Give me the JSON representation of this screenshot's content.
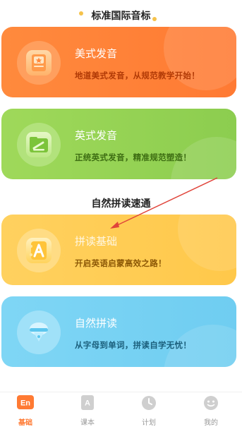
{
  "section1": {
    "title": "标准国际音标"
  },
  "section2": {
    "title": "自然拼读速通"
  },
  "cards": [
    {
      "title": "美式发音",
      "subtitle": "地道美式发音，从规范教学开始！",
      "icon": "book-icon"
    },
    {
      "title": "英式发音",
      "subtitle": "正统英式发音，精准规范塑造！",
      "icon": "folder-icon"
    },
    {
      "title": "拼读基础",
      "subtitle": "开启英语启蒙高效之路！",
      "icon": "letter-a-card-icon"
    },
    {
      "title": "自然拼读",
      "subtitle": "从字母到单词，拼读自学无忧！",
      "icon": "ice-cream-icon"
    }
  ],
  "tabs": [
    {
      "label": "基础",
      "icon_text": "En",
      "icon": "en-icon",
      "active": true
    },
    {
      "label": "课本",
      "icon_text": "A",
      "icon": "textbook-icon",
      "active": false
    },
    {
      "label": "计划",
      "icon": "clock-icon",
      "active": false
    },
    {
      "label": "我的",
      "icon": "smiley-icon",
      "active": false
    }
  ],
  "colors": {
    "accent": "#ff7a33",
    "card_orange": "#ff8a3d",
    "card_green": "#9fd95a",
    "card_yellow": "#ffd15f",
    "card_blue": "#7fd6f5",
    "annotation_arrow": "#e0443a"
  }
}
